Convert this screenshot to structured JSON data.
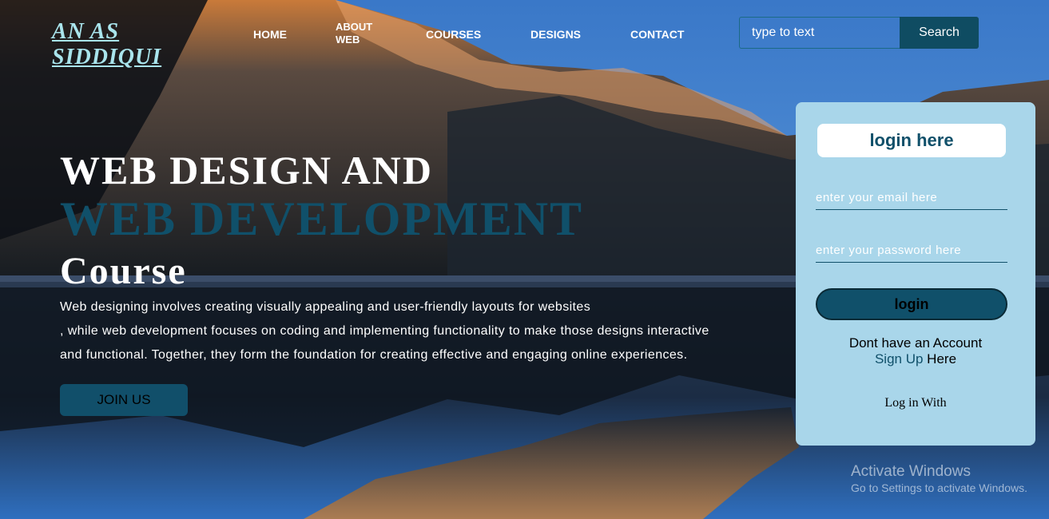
{
  "brand": {
    "logo_line1": "AN AS",
    "logo_line2": "SIDDIQUI"
  },
  "nav": {
    "home": "HOME",
    "about_line1": "ABOUT",
    "about_line2": "WEB",
    "courses": "COURSES",
    "designs": "DESIGNS",
    "contact": "CONTACT"
  },
  "search": {
    "placeholder": "type to text",
    "button_label": "Search"
  },
  "hero": {
    "line1": "WEB DESIGN AND",
    "line2": "WEB DEVELOPMENT",
    "line3": "Course",
    "desc_line1": "Web designing involves creating visually appealing and user-friendly layouts for websites",
    "desc_line2": ", while web development focuses on coding and implementing functionality to make those designs interactive",
    "desc_line3": "and functional. Together, they form the foundation for creating effective and engaging online experiences.",
    "join_label": "JOIN US"
  },
  "login": {
    "title": "login here",
    "email_placeholder": "enter your email here",
    "password_placeholder": "enter your password here",
    "button_label": "login",
    "no_account": "Dont have an Account",
    "signup_link": "Sign Up",
    "signup_suffix": " Here",
    "log_in_with": "Log in With"
  },
  "os_watermark": {
    "title": "Activate Windows",
    "subtitle": "Go to Settings to activate Windows."
  },
  "colors": {
    "accent": "#10506a",
    "logo": "#a9e4ec",
    "card_bg": "#a9d6ea"
  }
}
